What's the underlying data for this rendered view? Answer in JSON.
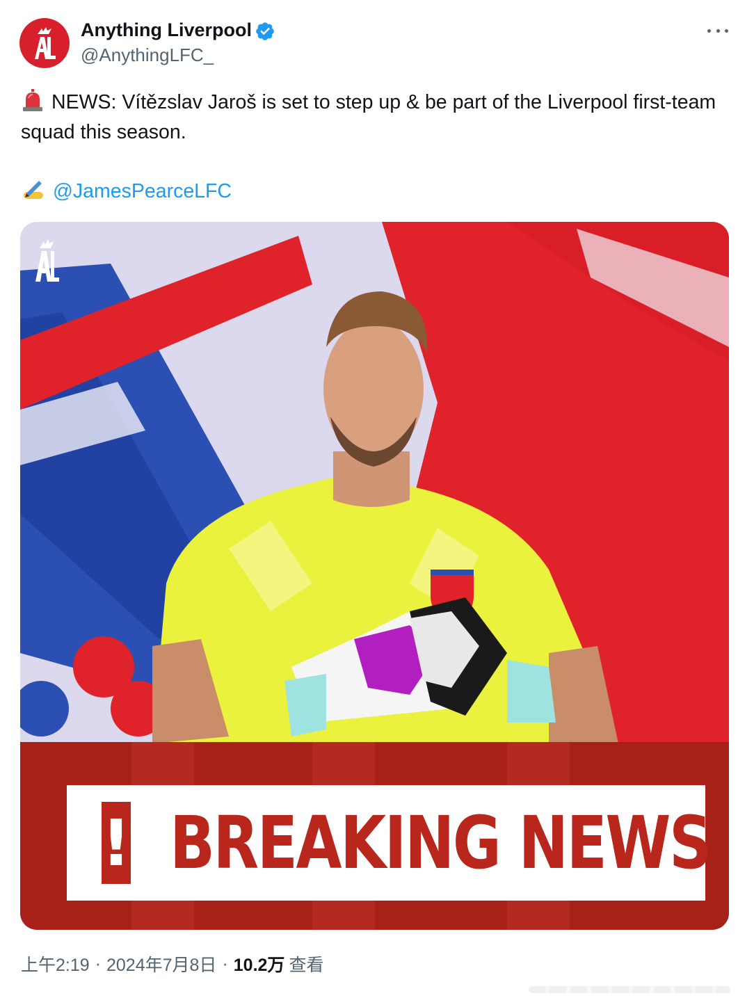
{
  "author": {
    "name": "Anything Liverpool",
    "handle": "@AnythingLFC_",
    "verified": true,
    "avatar_color": "#d7202b",
    "avatar_icon": "al-logo-icon"
  },
  "tweet": {
    "emoji_prefix": "siren-icon",
    "text": "NEWS: Vítězslav Jaroš is set to step up & be part of the Liverpool first-team squad this season.",
    "credit_emoji": "writing-hand-icon",
    "credit_mention": "@JamesPearceLFC",
    "media": {
      "banner_text": "BREAKING NEWS",
      "alert_glyph": "!",
      "banner_color": "#a82119"
    }
  },
  "meta": {
    "time": "上午2:19",
    "separator": "·",
    "date": "2024年7月8日",
    "views_count": "10.2万",
    "views_label": "查看"
  },
  "colors": {
    "accent": "#1d9bf0",
    "secondary_text": "#536471",
    "primary_text": "#0f1419"
  }
}
